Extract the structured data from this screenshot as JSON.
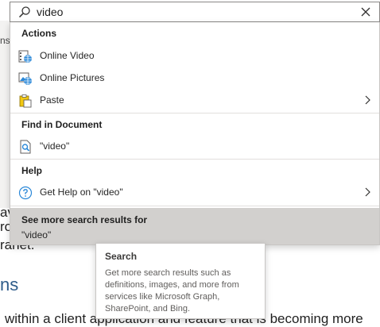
{
  "search": {
    "value": "video",
    "placeholder": ""
  },
  "background": {
    "left_fragments": [
      "ns"
    ],
    "doc_lines": [
      "av",
      "ro",
      "ranet.",
      "within a client application and feature that is becoming more"
    ],
    "heading": "ns"
  },
  "sections": {
    "actions": {
      "title": "Actions",
      "items": [
        {
          "label": "Online Video",
          "icon": "online-video-icon"
        },
        {
          "label": "Online Pictures",
          "icon": "online-pictures-icon"
        },
        {
          "label": "Paste",
          "icon": "paste-icon",
          "has_submenu": true
        }
      ]
    },
    "find": {
      "title": "Find in Document",
      "items": [
        {
          "label": "\"video\"",
          "icon": "find-document-icon"
        }
      ]
    },
    "help": {
      "title": "Help",
      "items": [
        {
          "label": "Get Help on \"video\"",
          "icon": "help-icon",
          "has_submenu": true
        }
      ]
    }
  },
  "more_results": {
    "title": "See more search results for",
    "query": "\"video\""
  },
  "tooltip": {
    "title": "Search",
    "body": "Get more search results such as definitions, images, and more from services like Microsoft Graph, SharePoint, and Bing."
  },
  "colors": {
    "accent_blue": "#2b88d8",
    "selected_bg": "#d2d0ce",
    "border": "#8a8886"
  }
}
